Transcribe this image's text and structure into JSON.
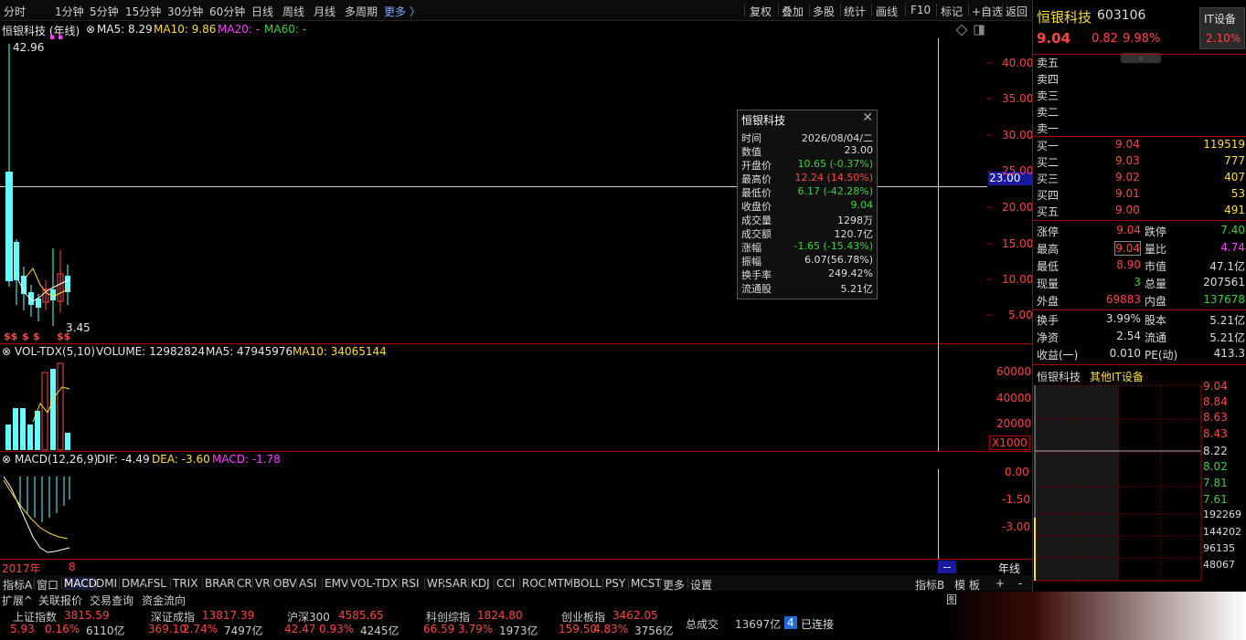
{
  "periods": [
    "分时",
    "1分钟",
    "5分钟",
    "15分钟",
    "30分钟",
    "60分钟",
    "日线",
    "周线",
    "月线",
    "多周期",
    "更多 〉"
  ],
  "tools": [
    "复权",
    "叠加",
    "多股",
    "统计",
    "画线",
    "F10",
    "标记",
    "+自选",
    "返回"
  ],
  "main_legend": {
    "name": "恒银科技 (年线)",
    "ma5": "MA5: 8.29",
    "ma10": "MA10: 9.86",
    "ma20": "MA20: -",
    "ma60": "MA60: -"
  },
  "price_labels": {
    "high": "42.96",
    "low": "3.45",
    "signal": "$$",
    "signal2": "$"
  },
  "crosshair_value": "23.00",
  "price_axis": [
    "40.00",
    "35.00",
    "30.00",
    "25.00",
    "20.00",
    "15.00",
    "10.00",
    "5.00"
  ],
  "vol_legend": {
    "name": "VOL-TDX(5,10)",
    "volume": "VOLUME: 12982824",
    "ma5": "MA5: 47945976",
    "ma10": "MA10: 34065144"
  },
  "vol_axis": [
    "60000",
    "40000",
    "20000"
  ],
  "vol_unit": "X1000",
  "macd_legend": {
    "name": "MACD(12,26,9)",
    "dif": "DIF: -4.49",
    "dea": "DEA: -3.60",
    "macd": "MACD: -1.78"
  },
  "macd_axis": [
    "0.00",
    "-1.50",
    "-3.00"
  ],
  "time_axis": {
    "left": "2017年",
    "mid": "8",
    "right_marker": "--",
    "period": "年线"
  },
  "tooltip": {
    "title": "恒银科技",
    "close_icon": "close-icon",
    "rows": [
      {
        "k": "时间",
        "v": "2026/08/04/二",
        "c": "#dddddd"
      },
      {
        "k": "数值",
        "v": "23.00",
        "c": "#dddddd"
      },
      {
        "k": "开盘价",
        "v": "10.65 (-0.37%)",
        "c": "#3bd23b"
      },
      {
        "k": "最高价",
        "v": "12.24 (14.50%)",
        "c": "#ff4444"
      },
      {
        "k": "最低价",
        "v": "6.17 (-42.28%)",
        "c": "#3bd23b"
      },
      {
        "k": "收盘价",
        "v": "9.04",
        "c": "#3bd23b"
      },
      {
        "k": "成交量",
        "v": "1298万",
        "c": "#dddddd"
      },
      {
        "k": "成交额",
        "v": "120.7亿",
        "c": "#dddddd"
      },
      {
        "k": "涨幅",
        "v": "-1.65 (-15.43%)",
        "c": "#3bd23b"
      },
      {
        "k": "振幅",
        "v": "6.07(56.78%)",
        "c": "#dddddd"
      },
      {
        "k": "换手率",
        "v": "249.42%",
        "c": "#dddddd"
      },
      {
        "k": "流通股",
        "v": "5.21亿",
        "c": "#dddddd"
      }
    ]
  },
  "quote": {
    "name": "恒银科技",
    "code": "603106",
    "sector": "IT设备",
    "sector_pct": "2.10%",
    "price": "9.04",
    "change": "0.82",
    "pct": "9.98%",
    "asks": [
      {
        "label": "卖五",
        "price": "",
        "vol": ""
      },
      {
        "label": "卖四",
        "price": "",
        "vol": ""
      },
      {
        "label": "卖三",
        "price": "",
        "vol": ""
      },
      {
        "label": "卖二",
        "price": "",
        "vol": ""
      },
      {
        "label": "卖一",
        "price": "",
        "vol": ""
      }
    ],
    "bids": [
      {
        "label": "买一",
        "price": "9.04",
        "vol": "119519"
      },
      {
        "label": "买二",
        "price": "9.03",
        "vol": "777"
      },
      {
        "label": "买三",
        "price": "9.02",
        "vol": "407"
      },
      {
        "label": "买四",
        "price": "9.01",
        "vol": "53"
      },
      {
        "label": "买五",
        "price": "9.00",
        "vol": "491"
      }
    ],
    "stats": [
      {
        "l1": "涨停",
        "v1": "9.04",
        "c1": "#ff4444",
        "l2": "跌停",
        "v2": "7.40",
        "c2": "#3bd23b"
      },
      {
        "l1": "最高",
        "v1": "9.04",
        "c1": "#ff4444",
        "l2": "量比",
        "v2": "4.74",
        "c2": "#ff3bff"
      },
      {
        "l1": "最低",
        "v1": "8.90",
        "c1": "#ff4444",
        "l2": "市值",
        "v2": "47.1亿",
        "c2": "#dddddd"
      },
      {
        "l1": "现量",
        "v1": "3",
        "c1": "#3bd23b",
        "l2": "总量",
        "v2": "207561",
        "c2": "#dddddd"
      },
      {
        "l1": "外盘",
        "v1": "69883",
        "c1": "#ff4444",
        "l2": "内盘",
        "v2": "137678",
        "c2": "#3bd23b"
      }
    ],
    "stats2": [
      {
        "l1": "换手",
        "v1": "3.99%",
        "l2": "股本",
        "v2": "5.21亿"
      },
      {
        "l1": "净资",
        "v1": "2.54",
        "l2": "流通",
        "v2": "5.21亿"
      },
      {
        "l1": "收益(一)",
        "v1": "0.010",
        "l2": "PE(动)",
        "v2": "413.3"
      }
    ]
  },
  "mini_chart": {
    "tab1": "恒银科技",
    "tab2": "其他IT设备",
    "price_axis": [
      "9.04",
      "8.84",
      "8.63",
      "8.43",
      "8.22",
      "8.02",
      "7.81",
      "7.61"
    ],
    "vol_axis": [
      "192269",
      "144202",
      "96135",
      "48067"
    ]
  },
  "indicators": [
    "指标A",
    "窗口",
    "MACD",
    "DMI",
    "DMA",
    "FSL",
    "TRIX",
    "BRAR",
    "CR",
    "VR",
    "OBV",
    "ASI",
    "EMV",
    "VOL-TDX",
    "RSI",
    "WR",
    "SAR",
    "KDJ",
    "CCI",
    "ROC",
    "MTM",
    "BOLL",
    "PSY",
    "MCST",
    "更多",
    "设置"
  ],
  "indicators_right": [
    "指标B",
    "模 板",
    "+",
    "-"
  ],
  "ext_tabs": [
    "扩展^",
    "关联报价",
    "交易查询",
    "资金流向"
  ],
  "indices": [
    {
      "name": "上证指数",
      "value": "3815.59",
      "chg": "5.93",
      "pct": "0.16%",
      "amt": "6110亿"
    },
    {
      "name": "深证成指",
      "value": "13817.39",
      "chg": "369.10",
      "pct": "2.74%",
      "amt": "7497亿"
    },
    {
      "name": "沪深300",
      "value": "4585.65",
      "chg": "42.47",
      "pct": "0.93%",
      "amt": "4245亿"
    },
    {
      "name": "科创综指",
      "value": "1824.80",
      "chg": "66.59",
      "pct": "3.79%",
      "amt": "1973亿"
    },
    {
      "name": "创业板指",
      "value": "3462.05",
      "chg": "159.50",
      "pct": "4.83%",
      "amt": "3756亿"
    }
  ],
  "total": {
    "label": "总成交",
    "value": "13697亿",
    "conn_num": "4",
    "conn": "已连接"
  },
  "colors": {
    "up": "#ff4444",
    "down": "#63ffff",
    "border": "#aa0000"
  }
}
